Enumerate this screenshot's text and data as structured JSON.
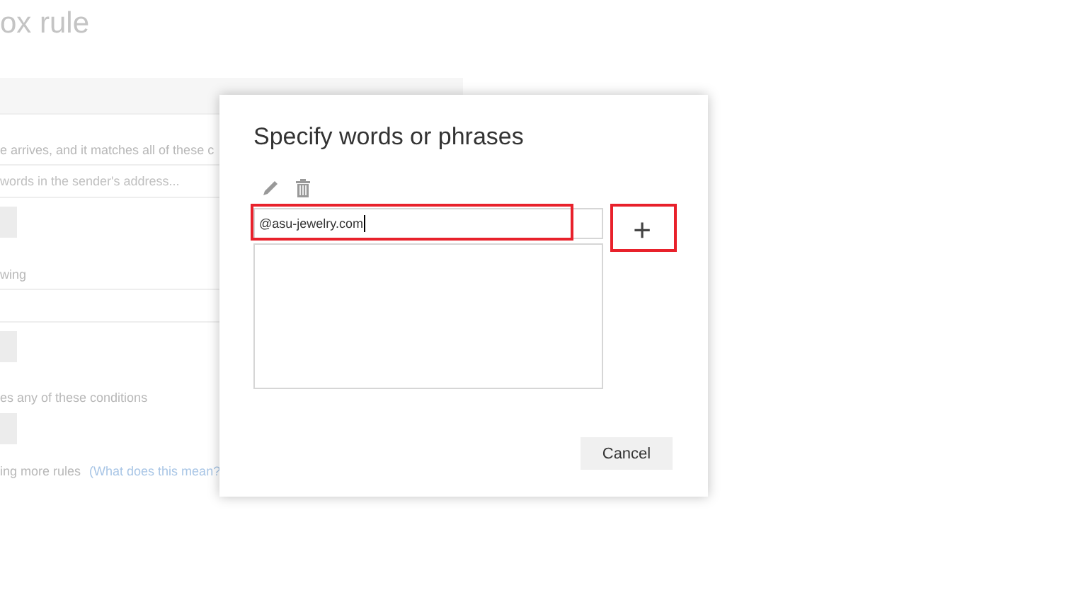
{
  "page": {
    "title": "ox rule",
    "condition_text": "e arrives, and it matches all of these c",
    "sender_field": {
      "placeholder": "words in the sender's address..."
    },
    "action_text": "wing",
    "exception_text": "es any of these conditions",
    "stop_text": "ing more rules",
    "help_link": "(What does this mean?"
  },
  "dialog": {
    "title": "Specify words or phrases",
    "input": {
      "value": "@asu-jewelry.com",
      "highlighted": true
    },
    "add_button": {
      "label": "+",
      "highlighted": true
    },
    "buttons": [
      "Cancel"
    ]
  }
}
